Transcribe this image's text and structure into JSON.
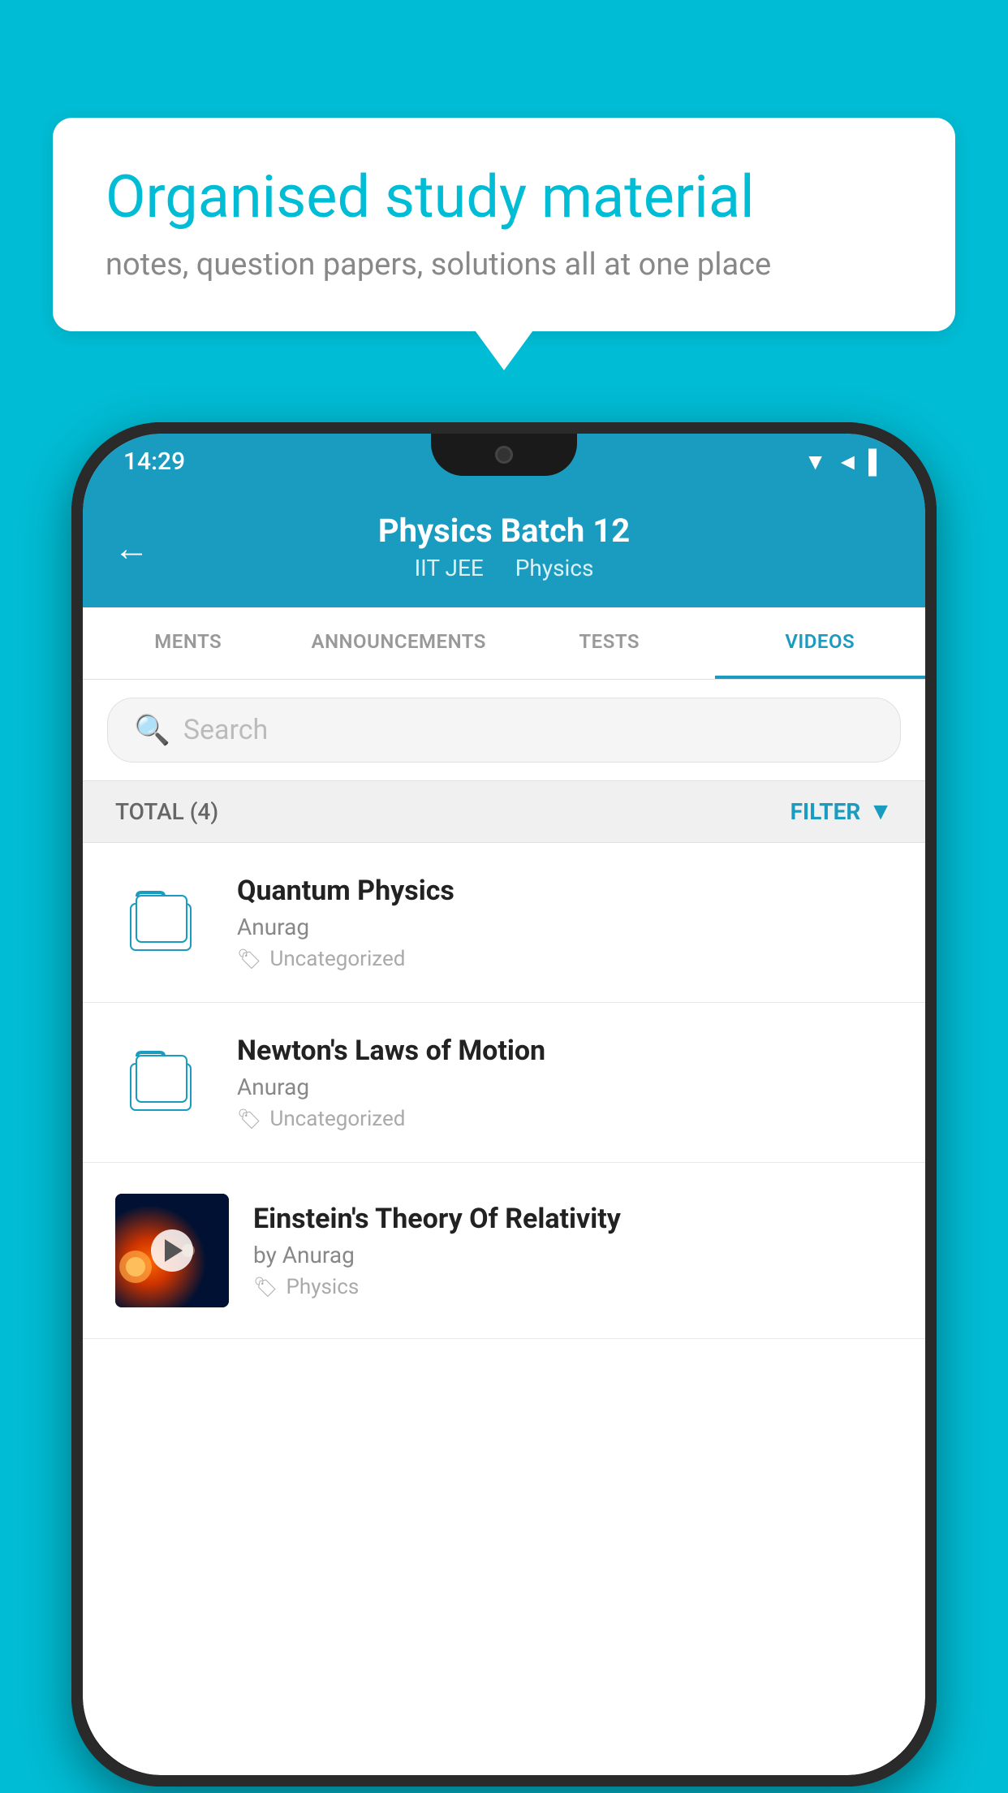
{
  "background": {
    "color": "#00bcd4"
  },
  "speech_bubble": {
    "title": "Organised study material",
    "subtitle": "notes, question papers, solutions all at one place"
  },
  "phone": {
    "status_bar": {
      "time": "14:29",
      "icons": [
        "wifi",
        "signal",
        "battery"
      ]
    },
    "header": {
      "back_icon": "←",
      "title": "Physics Batch 12",
      "subtitle_part1": "IIT JEE",
      "subtitle_part2": "Physics"
    },
    "tabs": [
      {
        "label": "MENTS",
        "active": false
      },
      {
        "label": "ANNOUNCEMENTS",
        "active": false
      },
      {
        "label": "TESTS",
        "active": false
      },
      {
        "label": "VIDEOS",
        "active": true
      }
    ],
    "search": {
      "placeholder": "Search"
    },
    "filter_bar": {
      "total_label": "TOTAL (4)",
      "filter_label": "FILTER"
    },
    "videos": [
      {
        "id": 1,
        "title": "Quantum Physics",
        "author": "Anurag",
        "tag": "Uncategorized",
        "type": "folder"
      },
      {
        "id": 2,
        "title": "Newton's Laws of Motion",
        "author": "Anurag",
        "tag": "Uncategorized",
        "type": "folder"
      },
      {
        "id": 3,
        "title": "Einstein's Theory Of Relativity",
        "author": "by Anurag",
        "tag": "Physics",
        "type": "video"
      }
    ]
  }
}
